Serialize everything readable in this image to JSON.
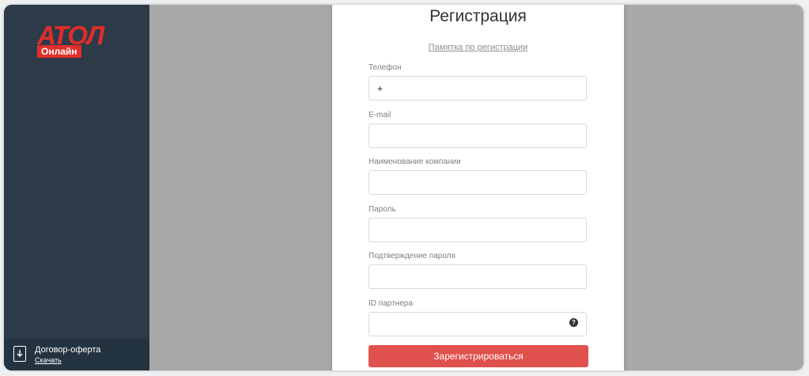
{
  "sidebar": {
    "logo_text": "АТОЛ",
    "logo_badge": "Онлайн",
    "footer": {
      "title": "Договор-оферта",
      "link": "Скачать"
    }
  },
  "form": {
    "title": "Регистрация",
    "memo_link": "Памятка по регистрации",
    "fields": [
      {
        "label": "Телефон",
        "value": "+",
        "placeholder": ""
      },
      {
        "label": "E-mail",
        "value": "",
        "placeholder": ""
      },
      {
        "label": "Наименование компании",
        "value": "",
        "placeholder": ""
      },
      {
        "label": "Пароль",
        "value": "",
        "placeholder": ""
      },
      {
        "label": "Подтверждение пароля",
        "value": "",
        "placeholder": ""
      },
      {
        "label": "ID партнера",
        "value": "",
        "placeholder": ""
      }
    ],
    "help_icon": "?",
    "submit_label": "Зарегистрироваться"
  },
  "colors": {
    "brand_red": "#e02d2a",
    "button_red": "#e0504d",
    "sidebar_bg": "#2d3b48",
    "overlay_gray": "#a9a9a9"
  }
}
